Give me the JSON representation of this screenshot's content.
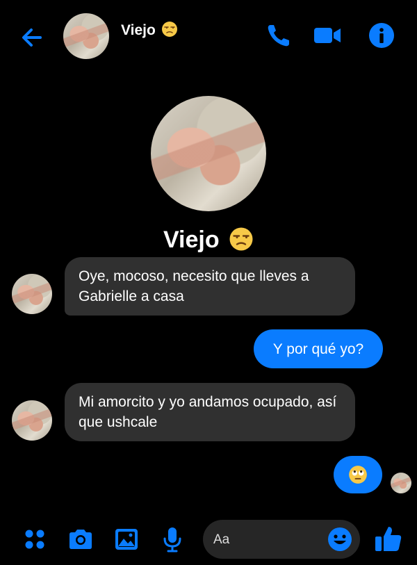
{
  "header": {
    "back_icon": "arrow-left-icon",
    "title": "Viejo",
    "title_emoji": "unamused-face",
    "actions": [
      "phone-icon",
      "video-camera-icon",
      "info-icon"
    ]
  },
  "profile": {
    "name": "Viejo",
    "name_emoji": "unamused-face"
  },
  "messages": [
    {
      "direction": "incoming",
      "text": "Oye, mocoso, necesito que lleves a Gabrielle a casa"
    },
    {
      "direction": "outgoing",
      "text": "Y por qué yo?"
    },
    {
      "direction": "incoming",
      "text": "Mi amorcito y yo andamos ocupado, así que ushcale"
    },
    {
      "direction": "outgoing",
      "emoji": "face-with-rolling-eyes"
    }
  ],
  "composer": {
    "placeholder": "Aa",
    "tools": [
      "apps-icon",
      "camera-icon",
      "gallery-icon",
      "microphone-icon"
    ],
    "emoji_icon": "smiley-icon",
    "send_icon": "thumbs-up-icon"
  },
  "colors": {
    "background": "#000000",
    "accent": "#0a7cff",
    "incoming_bubble": "#303030",
    "input_bg": "#262626"
  }
}
